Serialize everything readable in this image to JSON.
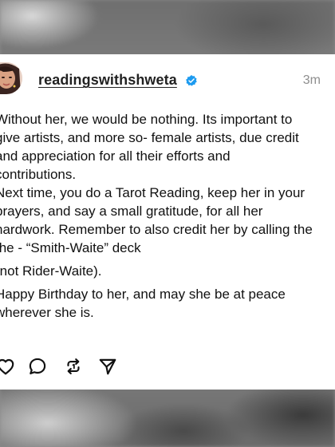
{
  "post": {
    "username": "readingswithshweta",
    "time": "3m",
    "lines": [
      "Without her, we would be nothing. Its important to",
      "give artists, and more so- female artists, due credit",
      "and appreciation for all their efforts and",
      "contributions.",
      "Next time, you do a Tarot Reading, keep her in your",
      "prayers, and say a small gratitude, for all her",
      "hardwork. Remember to also credit her by calling the",
      "the - “Smith-Waite” deck",
      "(not Rider-Waite).",
      "Happy Birthday to her, and may she be at peace",
      "wherever she is."
    ]
  },
  "icons": {
    "verified": "verified-badge-icon",
    "like": "heart-icon",
    "comment": "comment-icon",
    "repost": "repost-icon",
    "share": "send-icon"
  },
  "colors": {
    "verified": "#1d9bf0",
    "text": "#111111",
    "muted": "#8e8e8e"
  }
}
